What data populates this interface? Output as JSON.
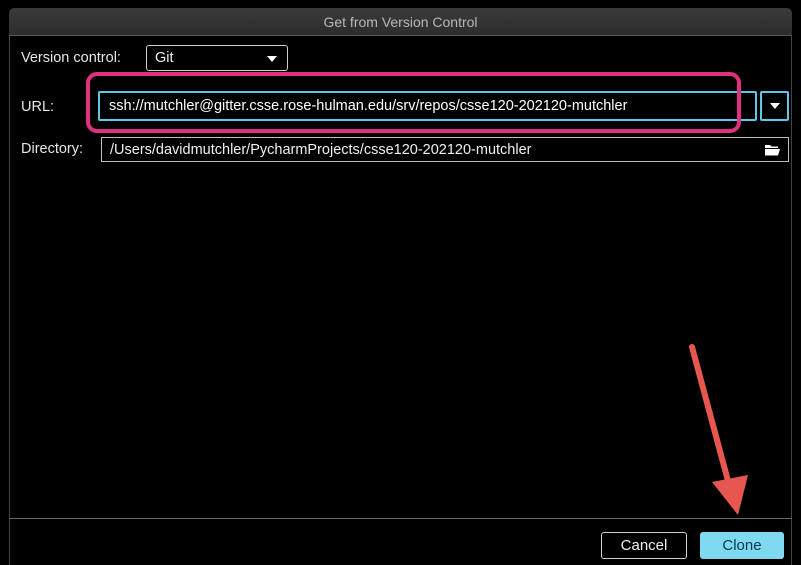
{
  "window": {
    "title": "Get from Version Control"
  },
  "version_control": {
    "label": "Version control:",
    "value": "Git"
  },
  "url": {
    "label": "URL:",
    "value": "ssh://mutchler@gitter.csse.rose-hulman.edu/srv/repos/csse120-202120-mutchler"
  },
  "directory": {
    "label": "Directory:",
    "value": "/Users/davidmutchler/PycharmProjects/csse120-202120-mutchler"
  },
  "buttons": {
    "cancel": "Cancel",
    "clone": "Clone"
  },
  "colors": {
    "highlight_box": "#e0307e",
    "annotation_arrow": "#e8574f",
    "focus_ring": "#5fc8e6",
    "clone_button": "#7fd9f0"
  },
  "icons": {
    "dropdown": "chevron-down-icon",
    "browse": "folder-open-icon",
    "annotation": "arrow-icon"
  }
}
